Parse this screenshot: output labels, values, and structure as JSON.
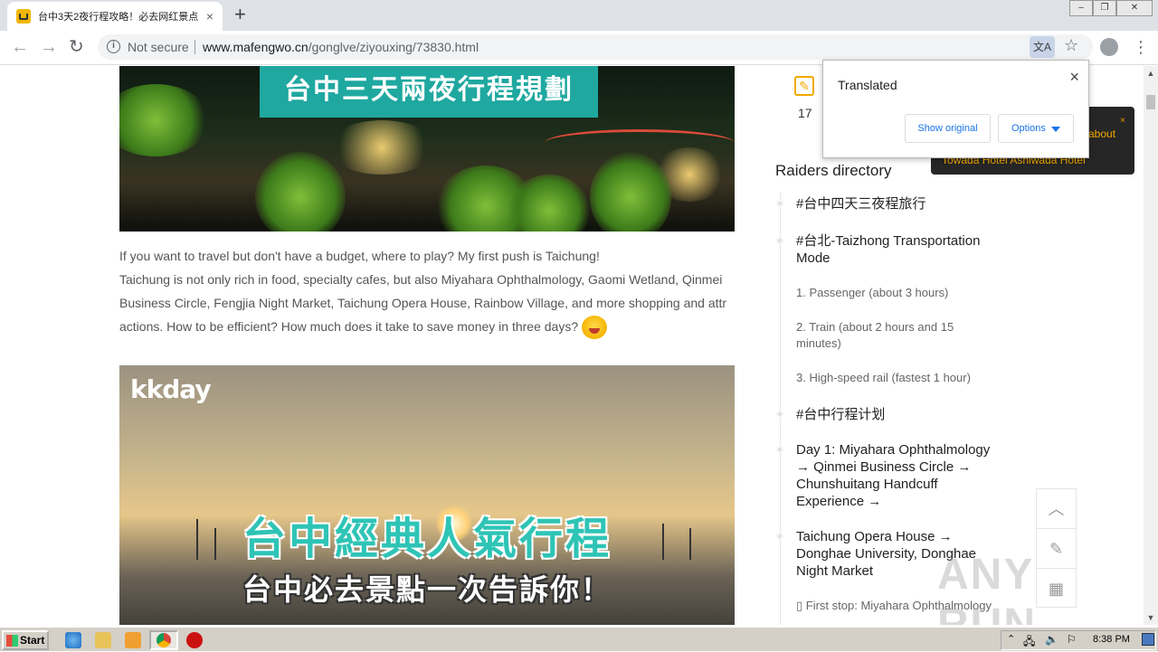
{
  "browser": {
    "tab_title": "台中3天2夜行程攻略！必去网红景点",
    "tab_close": "×",
    "new_tab": "+",
    "security_label": "Not secure",
    "url_domain": "www.mafengwo.cn",
    "url_path": "/gonglve/ziyouxing/73830.html"
  },
  "translate_popup": {
    "title": "Translated",
    "show_original": "Show original",
    "options": "Options",
    "close": "×"
  },
  "article": {
    "banner1_text": "台中三天兩夜行程規劃",
    "paragraph_line1": "If you want to travel but don't have a budget, where to play? My first push is Taichung!",
    "paragraph_line2": "Taichung is not only rich in food, specialty cafes, but also Miyahara Ophthalmology, Gaomi Wetland, Qinmei Business Circle, Fengjia Night Market, Taichung Opera House, Rainbow Village, and more shopping and attr actions. How to be efficient? How much does it take to save money in three days?",
    "banner2_logo": "kkday",
    "banner2_title": "台中經典人氣行程",
    "banner2_subtitle": "台中必去景點一次告訴你！"
  },
  "sidebar": {
    "comment_count": "17",
    "promo_text1": "about",
    "promo_text2": "Towada Hotel Ashiwada Hotel",
    "promo_close": "×",
    "directory_title": "Raiders directory",
    "items": [
      {
        "label": "#台中四天三夜程旅行",
        "kind": "h"
      },
      {
        "label": "#台北-Taizhong Transportation Mode",
        "kind": "h"
      },
      {
        "label": "1. Passenger (about 3 hours)",
        "kind": "s"
      },
      {
        "label": "2. Train (about 2 hours and 15 minutes)",
        "kind": "s"
      },
      {
        "label": "3. High-speed rail (fastest 1 hour)",
        "kind": "s"
      },
      {
        "label": "#台中行程计划",
        "kind": "h"
      },
      {
        "label": "Day 1: Miyahara Ophthalmology → Qinmei Business Circle → Chunshuitang Handcuff Experience →",
        "kind": "h"
      },
      {
        "label": "Taichung Opera House → Donghae University, Donghae Night Market",
        "kind": "h"
      },
      {
        "label": "▯ First stop: Miyahara Ophthalmology",
        "kind": "s"
      }
    ]
  },
  "watermark": "ANY RUN",
  "taskbar": {
    "start_label": "Start",
    "clock": "8:38 PM"
  }
}
